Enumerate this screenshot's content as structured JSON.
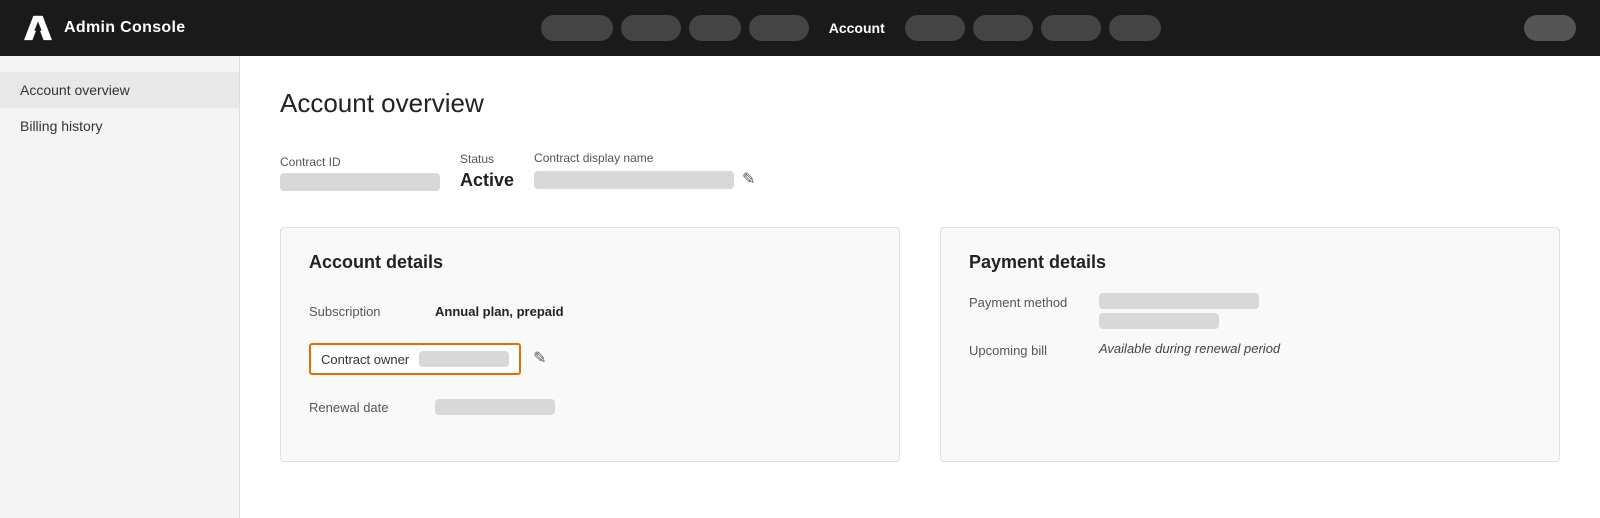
{
  "topnav": {
    "logo_text": "Admin Console",
    "nav_items": [
      "",
      "",
      "",
      "",
      "",
      "",
      "",
      ""
    ],
    "account_label": "Account",
    "nav_pills_left": [
      {
        "width": "wide"
      },
      {
        "width": "medium"
      },
      {
        "width": "narrow"
      },
      {
        "width": "medium"
      }
    ],
    "nav_pills_right": [
      {
        "width": "medium"
      },
      {
        "width": "medium"
      },
      {
        "width": "medium"
      },
      {
        "width": "narrow"
      }
    ]
  },
  "sidebar": {
    "items": [
      {
        "label": "Account overview",
        "active": true
      },
      {
        "label": "Billing history",
        "active": false
      }
    ]
  },
  "main": {
    "page_title": "Account overview",
    "contract_id_label": "Contract ID",
    "status_label": "Status",
    "status_value": "Active",
    "contract_display_name_label": "Contract display name",
    "account_details": {
      "title": "Account details",
      "subscription_label": "Subscription",
      "subscription_value": "Annual plan, prepaid",
      "contract_owner_label": "Contract owner",
      "renewal_date_label": "Renewal date"
    },
    "payment_details": {
      "title": "Payment details",
      "payment_method_label": "Payment method",
      "upcoming_bill_label": "Upcoming bill",
      "upcoming_bill_value": "Available during renewal period"
    }
  }
}
